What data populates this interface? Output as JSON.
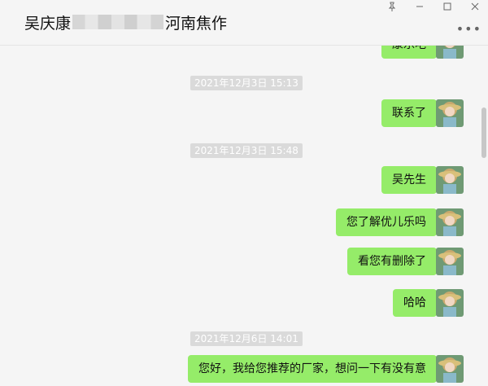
{
  "window": {
    "title_left": "吴庆康",
    "title_right": "河南焦作"
  },
  "chat": {
    "messages": [
      {
        "text": "康乐吧",
        "from": "me"
      },
      {
        "timestamp": "2021年12月3日 15:13"
      },
      {
        "text": "联系了",
        "from": "me"
      },
      {
        "timestamp": "2021年12月3日 15:48"
      },
      {
        "text": "吴先生",
        "from": "me"
      },
      {
        "text": "您了解优儿乐吗",
        "from": "me"
      },
      {
        "text": "看您有删除了",
        "from": "me"
      },
      {
        "text": "哈哈",
        "from": "me"
      },
      {
        "timestamp": "2021年12月6日 14:01"
      },
      {
        "text": "您好，我给您推荐的厂家，想问一下有没有意",
        "from": "me"
      }
    ]
  },
  "colors": {
    "sent_bubble": "#95ec69",
    "timestamp_bg": "#dadada",
    "background": "#f5f5f5"
  },
  "icons": [
    "pin-icon",
    "minimize-icon",
    "maximize-icon",
    "close-icon",
    "more-icon",
    "user-avatar"
  ]
}
